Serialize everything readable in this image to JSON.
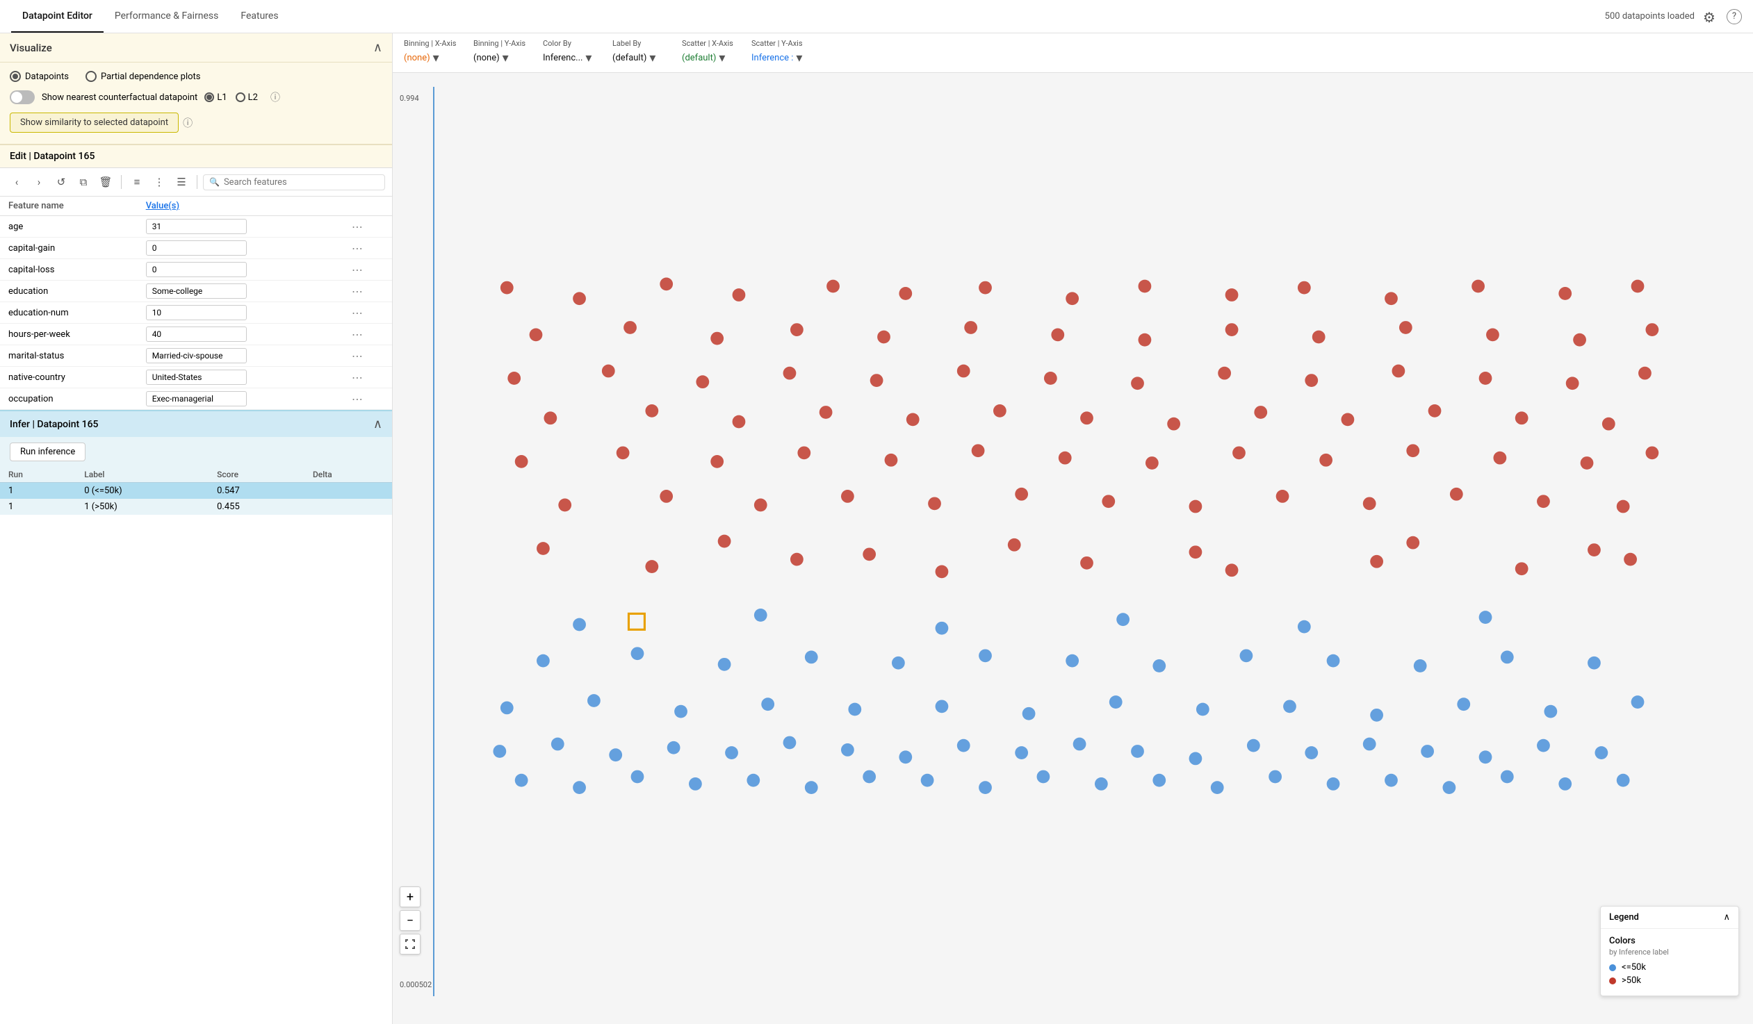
{
  "nav": {
    "tabs": [
      {
        "label": "Datapoint Editor",
        "active": true
      },
      {
        "label": "Performance & Fairness",
        "active": false
      },
      {
        "label": "Features",
        "active": false
      }
    ],
    "status": "500 datapoints loaded"
  },
  "visualize": {
    "title": "Visualize",
    "radio_options": [
      "Datapoints",
      "Partial dependence plots"
    ],
    "selected_radio": "Datapoints",
    "toggle_label": "Show nearest counterfactual datapoint",
    "l1_label": "L1",
    "l2_label": "L2",
    "similarity_btn": "Show similarity to selected datapoint"
  },
  "edit": {
    "title": "Edit | Datapoint 165",
    "search_placeholder": "Search features",
    "columns": [
      "Feature name",
      "Value(s)"
    ],
    "rows": [
      {
        "feature": "age",
        "value": "31"
      },
      {
        "feature": "capital-gain",
        "value": "0"
      },
      {
        "feature": "capital-loss",
        "value": "0"
      },
      {
        "feature": "education",
        "value": "Some-college"
      },
      {
        "feature": "education-num",
        "value": "10"
      },
      {
        "feature": "hours-per-week",
        "value": "40"
      },
      {
        "feature": "marital-status",
        "value": "Married-civ-spouse"
      },
      {
        "feature": "native-country",
        "value": "United-States"
      },
      {
        "feature": "occupation",
        "value": "Exec-managerial"
      }
    ]
  },
  "infer": {
    "title": "Infer | Datapoint 165",
    "run_btn": "Run inference",
    "columns": [
      "Run",
      "Label",
      "Score",
      "Delta"
    ],
    "rows": [
      {
        "run": "1",
        "label": "0 (<=50k)",
        "score": "0.547",
        "delta": "",
        "highlight": true
      },
      {
        "run": "1",
        "label": "1 (>50k)",
        "score": "0.455",
        "delta": "",
        "highlight": false
      }
    ]
  },
  "controls": {
    "binning_x": {
      "label": "Binning | X-Axis",
      "value": "(none)",
      "color": "orange"
    },
    "binning_y": {
      "label": "Binning | Y-Axis",
      "value": "(none)",
      "color": "dark"
    },
    "color_by": {
      "label": "Color By",
      "value": "Inferenc...",
      "color": "dark"
    },
    "label_by": {
      "label": "Label By",
      "value": "(default)",
      "color": "dark"
    },
    "scatter_x": {
      "label": "Scatter | X-Axis",
      "value": "(default)",
      "color": "green"
    },
    "scatter_y": {
      "label": "Scatter | Y-Axis",
      "value": "Inference :",
      "color": "blue"
    }
  },
  "yaxis": {
    "top": "0.994",
    "bottom": "0.000502"
  },
  "legend": {
    "title": "Legend",
    "colors_title": "Colors",
    "colors_subtitle": "by Inference label",
    "items": [
      {
        "label": "<=50k",
        "color": "blue"
      },
      {
        "label": ">50k",
        "color": "red"
      }
    ]
  },
  "icons": {
    "settings": "⚙",
    "help": "?",
    "back": "‹",
    "forward": "›",
    "undo": "↺",
    "copy": "⧉",
    "delete": "🗑",
    "list_single": "≡",
    "list_numbered": "⋮",
    "list_bullets": "☰",
    "search": "🔍",
    "collapse": "∧",
    "expand": "∨",
    "info": "ⓘ",
    "more": "⋯",
    "plus": "+",
    "minus": "−",
    "fullscreen": "⛶",
    "dropdown": "▾"
  }
}
